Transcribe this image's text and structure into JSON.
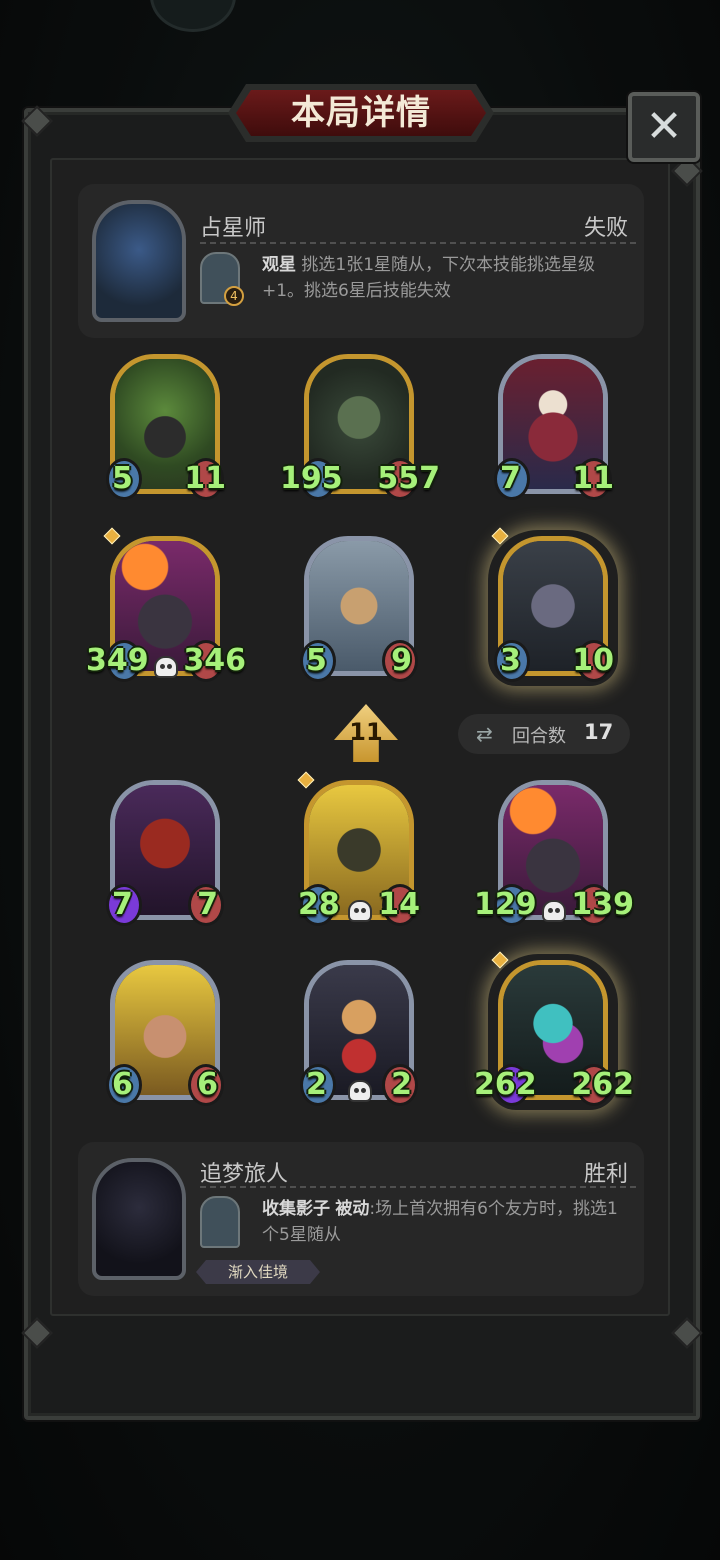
{
  "dialog": {
    "title": "本局详情",
    "close_label": "✕"
  },
  "player": {
    "name": "占星师",
    "result": "失败",
    "skill_name": "观星",
    "skill_desc": "挑选1张1星随从，下次本技能挑选星级+1。挑选6星后技能失效",
    "skill_level": "4"
  },
  "rounds": {
    "label": "回合数",
    "value": "17"
  },
  "tavern_level": "11",
  "player_minions": [
    {
      "attack": "5",
      "health": "11",
      "frame": "gold",
      "art": "green-cat"
    },
    {
      "attack": "195",
      "health": "557",
      "frame": "gold",
      "art": "plant-monster"
    },
    {
      "attack": "7",
      "health": "11",
      "frame": "silver",
      "art": "clown"
    },
    {
      "attack": "349",
      "health": "346",
      "frame": "gold",
      "art": "fire-rat",
      "skull": true
    },
    {
      "attack": "5",
      "health": "9",
      "frame": "silver",
      "art": "scholar"
    },
    {
      "attack": "3",
      "health": "10",
      "frame": "gold",
      "art": "gray-rat",
      "glow": true
    }
  ],
  "opponent_minions": [
    {
      "attack": "7",
      "health": "7",
      "frame": "silver",
      "art": "hooded-assassin",
      "purple": true
    },
    {
      "attack": "28",
      "health": "14",
      "frame": "gold",
      "art": "goblin",
      "skull": true
    },
    {
      "attack": "129",
      "health": "139",
      "frame": "silver",
      "art": "fire-rat",
      "skull": true
    },
    {
      "attack": "6",
      "health": "6",
      "frame": "silver",
      "art": "minotaur"
    },
    {
      "attack": "2",
      "health": "2",
      "frame": "silver",
      "art": "puppet",
      "skull": true
    },
    {
      "attack": "262",
      "health": "262",
      "frame": "gold",
      "art": "serpent",
      "glow": true,
      "purple": true
    }
  ],
  "opponent": {
    "name": "追梦旅人",
    "result": "胜利",
    "skill_name": "收集影子",
    "skill_type": "被动",
    "skill_desc": ":场上首次拥有6个友方时，挑选1个5星随从",
    "tag": "渐入佳境"
  },
  "colors": {
    "stat_green": "#a6f07a",
    "title_red": "#6a1a1a",
    "gold_frame": "#c4962e",
    "silver_frame": "#8a94a8"
  }
}
